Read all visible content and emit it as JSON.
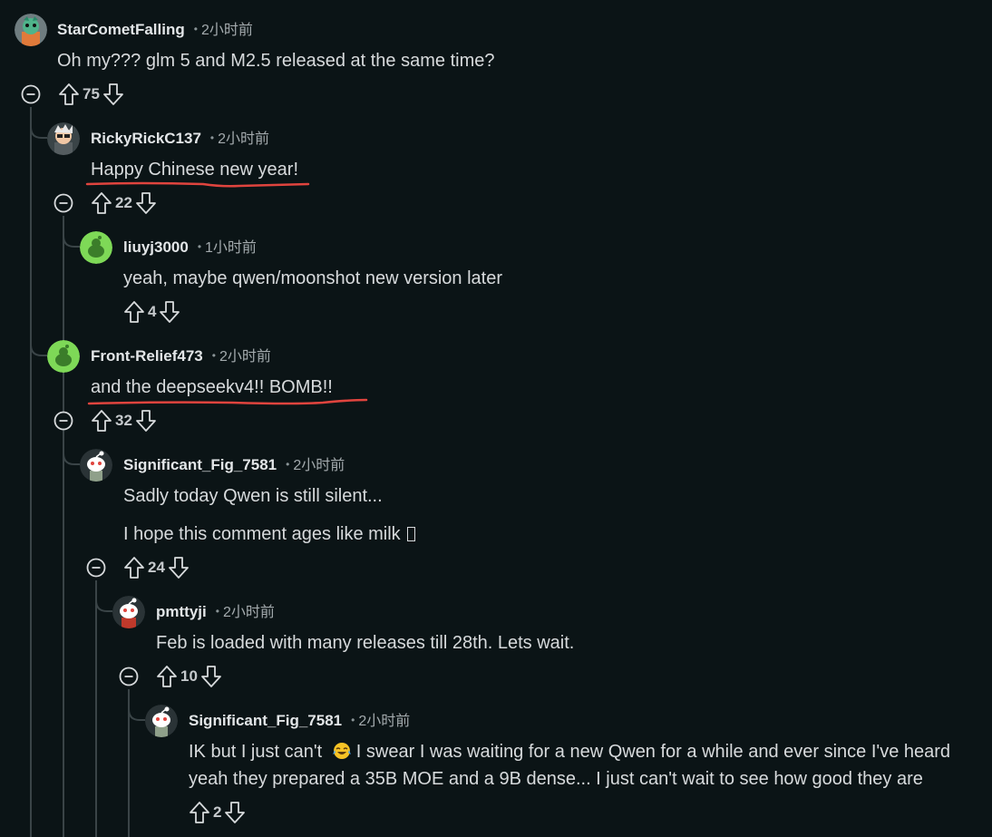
{
  "comments": [
    {
      "username": "StarCometFalling",
      "time": "2小时前",
      "text": "Oh my??? glm 5 and M2.5 released at the same time?",
      "score": "75"
    },
    {
      "username": "RickyRickC137",
      "time": "2小时前",
      "text": "Happy Chinese new year!",
      "score": "22"
    },
    {
      "username": "liuyj3000",
      "time": "1小时前",
      "text": "yeah, maybe qwen/moonshot new version later",
      "score": "4"
    },
    {
      "username": "Front-Relief473",
      "time": "2小时前",
      "text": "and the deepseekv4!! BOMB!!",
      "score": "32"
    },
    {
      "username": "Significant_Fig_7581",
      "time": "2小时前",
      "text": "Sadly today Qwen is still silent...",
      "text2": "I hope this comment ages like milk",
      "score": "24"
    },
    {
      "username": "pmttyji",
      "time": "2小时前",
      "text": "Feb is loaded with many releases till 28th. Lets wait.",
      "score": "10"
    },
    {
      "username": "Significant_Fig_7581",
      "time": "2小时前",
      "text_a": "IK but I just can't",
      "text_b": "I swear I was waiting for a new Qwen for a while and ever since I've heard",
      "text2": "yeah they prepared a 35B MOE and a 9B dense... I just can't wait to see how good they are",
      "score": "2"
    }
  ],
  "colors": {
    "background": "#0b1416",
    "highlight_underline": "#e0443e",
    "thread_line": "#3a4447"
  }
}
